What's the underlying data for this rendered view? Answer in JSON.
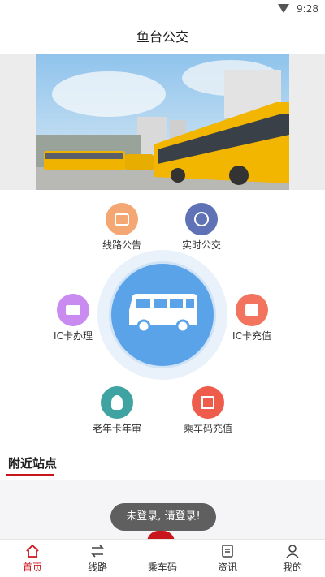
{
  "status_bar": {
    "time": "9:28",
    "wifi_icon": "wifi-icon"
  },
  "title_bar": {
    "title": "鱼台公交"
  },
  "banner": {
    "image": "bus-station-photo"
  },
  "menu": {
    "items": [
      {
        "label": "线路公告",
        "icon": "announcement-icon",
        "color": "#f4a673"
      },
      {
        "label": "实时公交",
        "icon": "realtime-bus-icon",
        "color": "#5f72b6"
      },
      {
        "label": "IC卡办理",
        "icon": "ic-card-icon",
        "color": "#c98bf0"
      },
      {
        "label": "IC卡充值",
        "icon": "card-topup-icon",
        "color": "#f2745e"
      },
      {
        "label": "老年卡年审",
        "icon": "elderly-icon",
        "color": "#3fa3a2"
      },
      {
        "label": "乘车码充值",
        "icon": "qr-topup-icon",
        "color": "#ee5c4c"
      }
    ],
    "center_icon": "bus-icon",
    "center_color": "#5aa3e8"
  },
  "nearby": {
    "label": "附近站点",
    "accent": "#c9161d"
  },
  "toast": {
    "text": "未登录, 请登录!"
  },
  "tabs": [
    {
      "label": "首页",
      "icon": "home-icon",
      "active": true
    },
    {
      "label": "线路",
      "icon": "route-icon",
      "active": false
    },
    {
      "label": "乘车码",
      "icon": "qr-code-icon",
      "active": false
    },
    {
      "label": "资讯",
      "icon": "news-icon",
      "active": false
    },
    {
      "label": "我的",
      "icon": "profile-icon",
      "active": false
    }
  ]
}
